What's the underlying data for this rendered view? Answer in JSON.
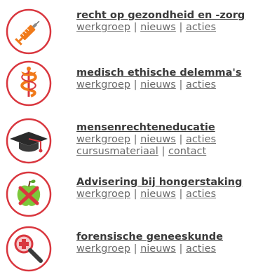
{
  "items": [
    {
      "title": "recht op gezondheid en -zorg",
      "icon": "syringe-icon",
      "links": [
        "werkgroep",
        "nieuws",
        "acties"
      ],
      "extra_links": []
    },
    {
      "title": "medisch ethische delemma's",
      "icon": "caduceus-icon",
      "links": [
        "werkgroep",
        "nieuws",
        "acties"
      ],
      "extra_links": []
    },
    {
      "title": "mensenrechteneducatie",
      "icon": "graduation-cap-icon",
      "links": [
        "werkgroep",
        "nieuws",
        "acties"
      ],
      "extra_links": [
        "cursusmateriaal",
        "contact"
      ]
    },
    {
      "title": "Advisering bij hongerstaking",
      "icon": "crossed-apple-icon",
      "links": [
        "werkgroep",
        "nieuws",
        "acties"
      ],
      "extra_links": []
    },
    {
      "title": "forensische geneeskunde",
      "icon": "magnifier-icon",
      "links": [
        "werkgroep",
        "nieuws",
        "acties"
      ],
      "extra_links": []
    }
  ],
  "separator": "|",
  "colors": {
    "ring": "#d9363e",
    "title_text": "#3a3a3a",
    "link_text": "#6a6a6a",
    "accent_orange": "#f07a1a"
  }
}
